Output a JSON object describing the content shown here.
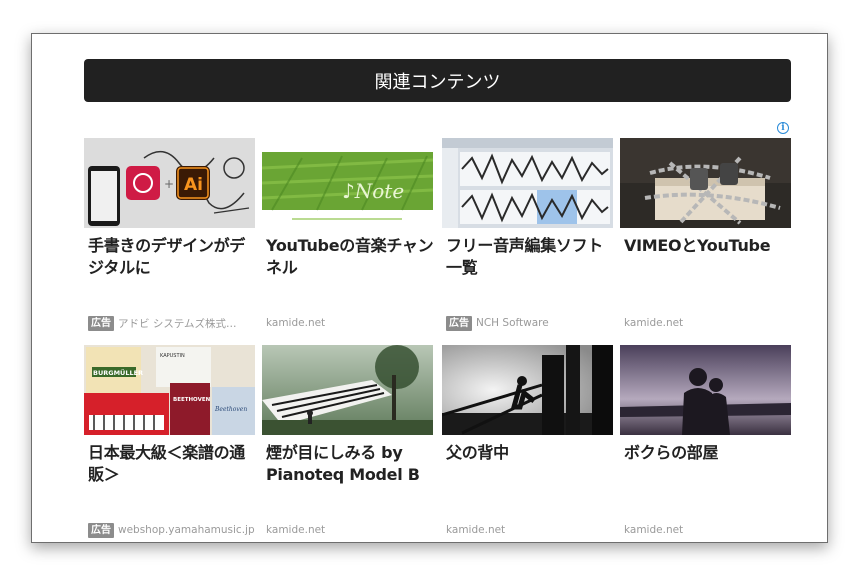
{
  "section": {
    "title": "関連コンテンツ",
    "ad_badge": "広告"
  },
  "cards": [
    {
      "title": "手書きのデザインがデジタルに",
      "source": "アドビ システムズ株式…",
      "ad": true,
      "thumb": "adobe-capture-image"
    },
    {
      "title": "YouTubeの音楽チャンネル",
      "source": "kamide.net",
      "ad": false,
      "thumb": "green-grass-note-image"
    },
    {
      "title": "フリー音声編集ソフト一覧",
      "source": "NCH Software",
      "ad": true,
      "thumb": "waveform-editor-image"
    },
    {
      "title": "VIMEOとYouTube",
      "source": "kamide.net",
      "ad": false,
      "thumb": "chained-book-image"
    },
    {
      "title": "日本最大級＜楽譜の通販＞",
      "source": "webshop.yamahamusic.jp",
      "ad": true,
      "thumb": "sheet-music-books-image"
    },
    {
      "title": "煙が目にしみる by Pianoteq Model B",
      "source": "kamide.net",
      "ad": false,
      "thumb": "piano-landscape-image"
    },
    {
      "title": "父の背中",
      "source": "kamide.net",
      "ad": false,
      "thumb": "silhouette-worker-image"
    },
    {
      "title": "ボクらの部屋",
      "source": "kamide.net",
      "ad": false,
      "thumb": "couple-silhouette-image"
    }
  ],
  "thumb_text": {
    "adobe_ai": "Ai",
    "note_text": "♪Note",
    "book1": "BURGMÜLLER",
    "book2": "BEETHOVEN",
    "book3": "Beethoven",
    "book4": "KAPUSTIN"
  },
  "colors": {
    "header_bg": "#212121",
    "info_icon": "#2a8bd8",
    "ad_badge_bg": "#8c8c8c"
  }
}
